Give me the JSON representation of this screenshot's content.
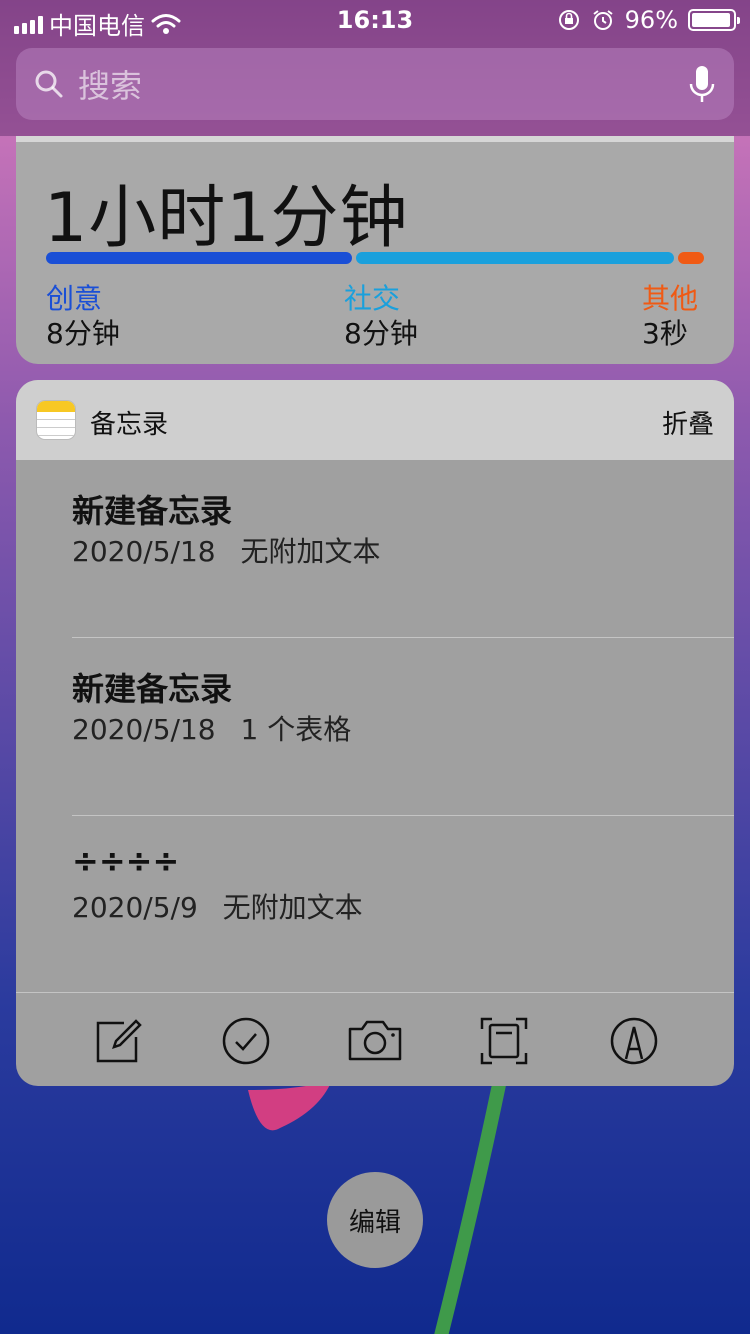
{
  "status_bar": {
    "carrier": "中国电信",
    "time": "16:13",
    "battery_percent": "96%",
    "battery_level": 0.96
  },
  "search": {
    "placeholder": "搜索"
  },
  "screen_time": {
    "total": "1小时1分钟",
    "categories": [
      {
        "label": "创意",
        "value": "8分钟",
        "color": "#1a4fd6",
        "share": 0.47
      },
      {
        "label": "社交",
        "value": "8分钟",
        "color": "#1aa0dc",
        "share": 0.49
      },
      {
        "label": "其他",
        "value": "3秒",
        "color": "#f05a14",
        "share": 0.04
      }
    ]
  },
  "notes_widget": {
    "app_name": "备忘录",
    "fold_label": "折叠",
    "items": [
      {
        "title": "新建备忘录",
        "date": "2020/5/18",
        "detail": "无附加文本"
      },
      {
        "title": "新建备忘录",
        "date": "2020/5/18",
        "detail": "1 个表格"
      },
      {
        "title": "÷÷÷÷",
        "date": "2020/5/9",
        "detail": "无附加文本"
      }
    ],
    "toolbar": [
      "compose-icon",
      "checklist-icon",
      "camera-icon",
      "scan-document-icon",
      "sketch-icon"
    ]
  },
  "edit_button": {
    "label": "编辑"
  }
}
